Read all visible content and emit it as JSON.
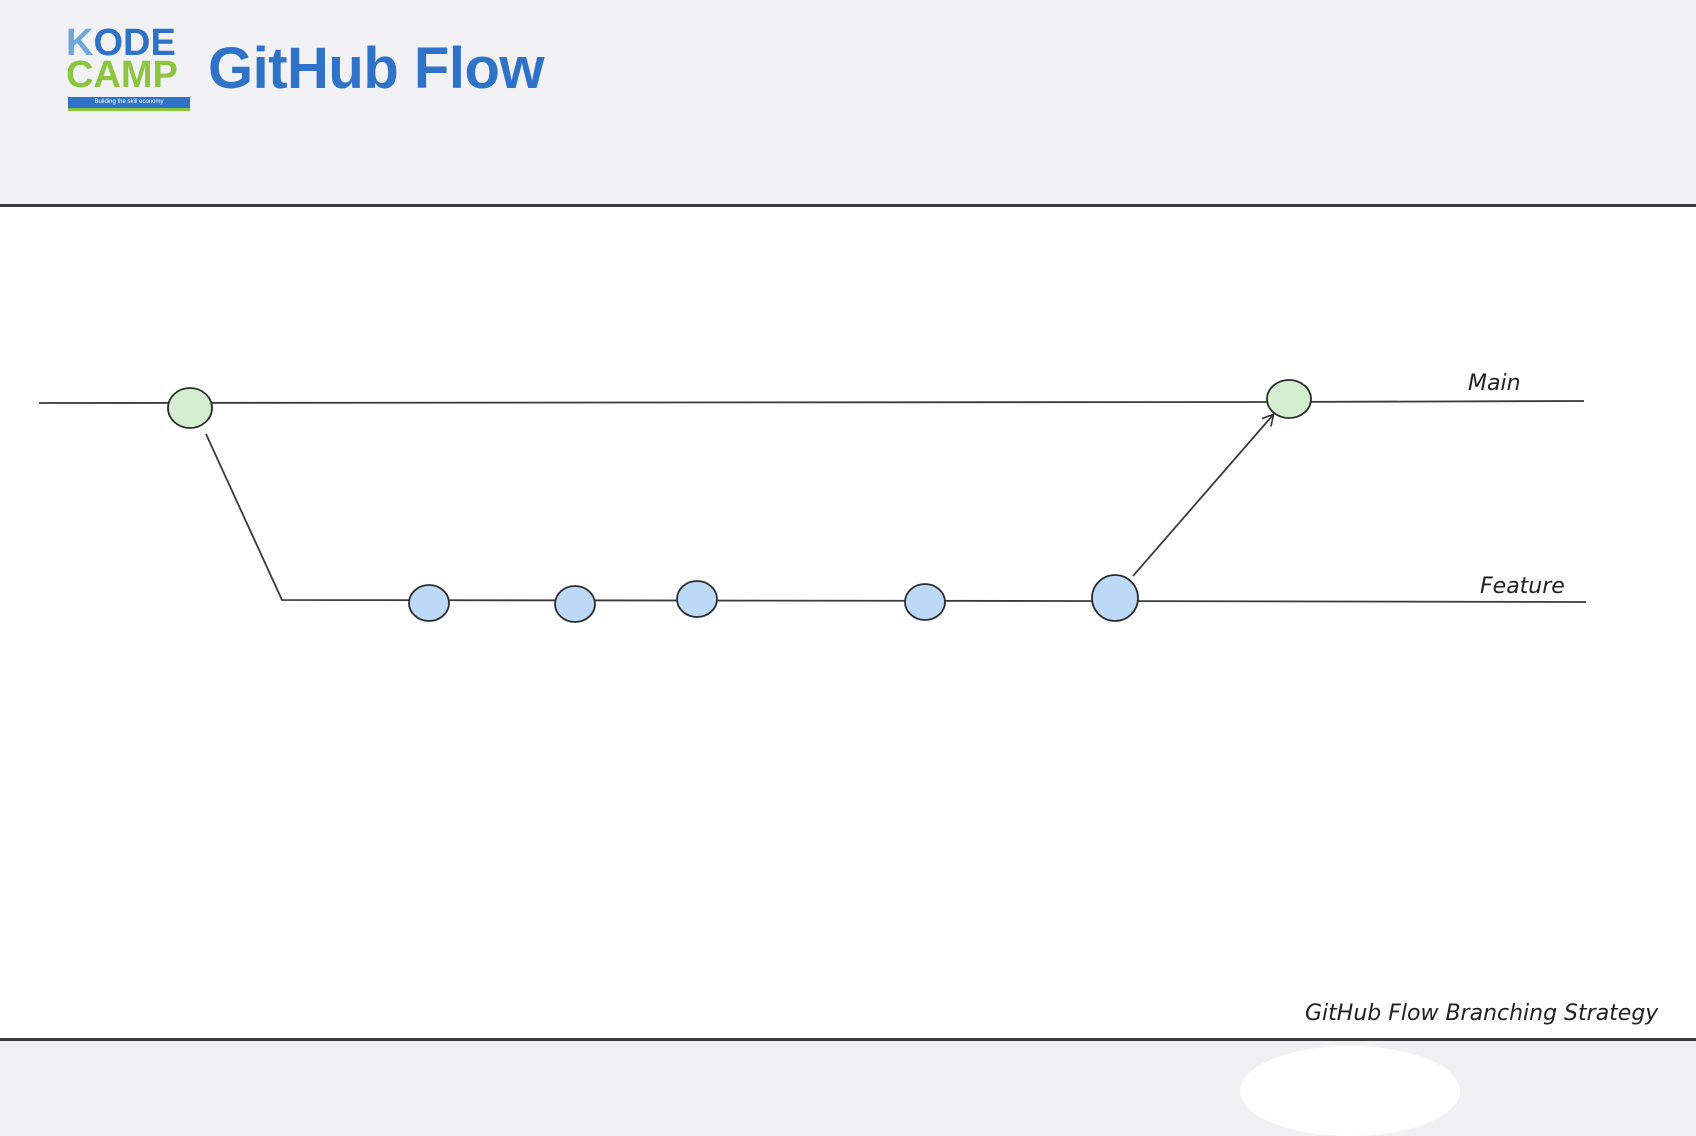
{
  "header": {
    "logo": {
      "line1_first": "K",
      "line1_rest": "ODE",
      "line2": "CAMP",
      "tagline": "Building the skill economy"
    },
    "title": "GitHub Flow"
  },
  "diagram": {
    "branches": [
      {
        "name": "Main",
        "color": "#d4efd0"
      },
      {
        "name": "Feature",
        "color": "#bcd9f7"
      }
    ],
    "main_commit_count": 2,
    "feature_commit_count": 5,
    "caption": "GitHub Flow Branching Strategy"
  }
}
